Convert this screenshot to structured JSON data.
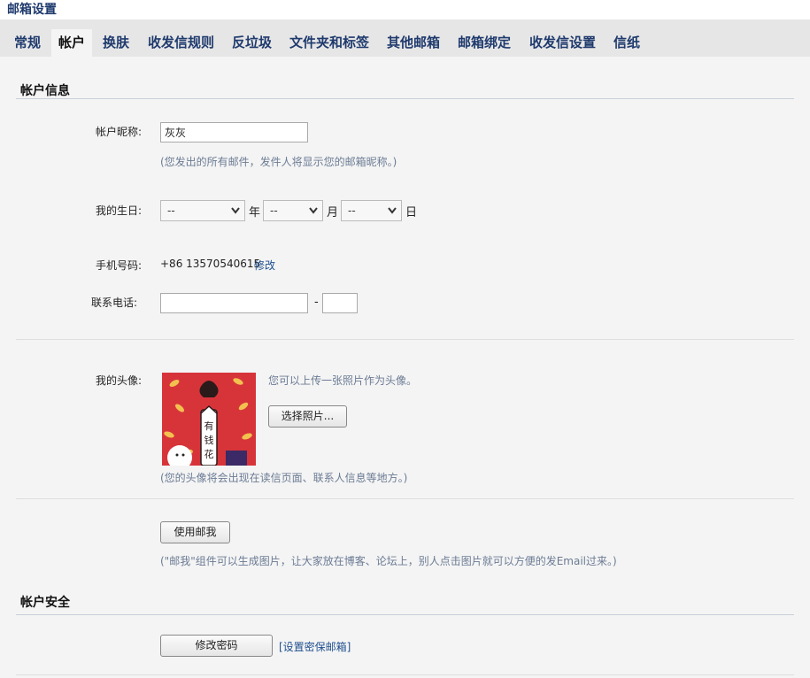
{
  "app": {
    "title": "邮箱设置"
  },
  "tabs": [
    {
      "label": "常规"
    },
    {
      "label": "帐户"
    },
    {
      "label": "换肤"
    },
    {
      "label": "收发信规则"
    },
    {
      "label": "反垃圾"
    },
    {
      "label": "文件夹和标签"
    },
    {
      "label": "其他邮箱"
    },
    {
      "label": "邮箱绑定"
    },
    {
      "label": "收发信设置"
    },
    {
      "label": "信纸"
    }
  ],
  "active_tab": "帐户",
  "account_info": {
    "heading": "帐户信息",
    "nickname": {
      "label": "帐户昵称:",
      "value": "灰灰",
      "hint": "(您发出的所有邮件，发件人将显示您的邮箱昵称。)"
    },
    "birthday": {
      "label": "我的生日:",
      "year_value": "--",
      "year_unit": "年",
      "month_value": "--",
      "month_unit": "月",
      "day_value": "--",
      "day_unit": "日"
    },
    "mobile": {
      "label": "手机号码:",
      "value": "+86 13570540615",
      "edit_link": "修改"
    },
    "phone": {
      "label": "联系电话:",
      "area_value": "",
      "separator": "-",
      "ext_value": ""
    },
    "avatar": {
      "label": "我的头像:",
      "upload_hint": "您可以上传一张照片作为头像。",
      "choose_button": "选择照片...",
      "image_text": "有钱花",
      "hint": "(您的头像将会出现在读信页面、联系人信息等地方。)"
    },
    "mail_me": {
      "button": "使用邮我",
      "hint": "(\"邮我\"组件可以生成图片，让大家放在博客、论坛上，别人点击图片就可以方便的发Email过来。)"
    }
  },
  "account_security": {
    "heading": "帐户安全",
    "change_password_button": "修改密码",
    "security_email_link": "[设置密保邮箱]"
  },
  "colors": {
    "accent": "#1f3a6d",
    "hint": "#6b7b94",
    "link": "#1f4f8f",
    "avatar_bg": "#d7343a"
  },
  "icons": {
    "select_arrow": "chevron-down-icon"
  }
}
